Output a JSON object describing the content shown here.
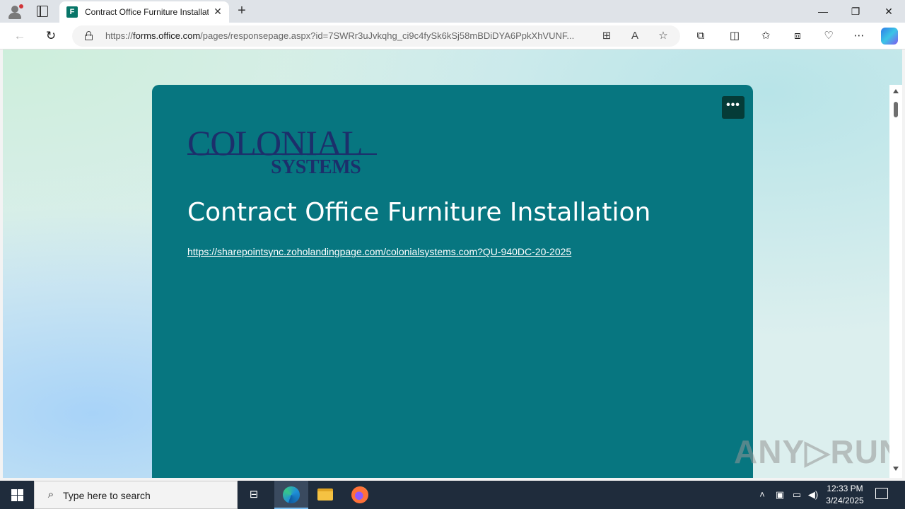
{
  "browser": {
    "tab": {
      "title": "Contract Office Furniture Installation",
      "favicon": "F"
    },
    "address": {
      "url_prefix": "https://",
      "url_domain": "forms.office.com",
      "url_rest": "/pages/responsepage.aspx?id=7SWRr3uJvkqhg_ci9c4fySk6kSj58mBDiDYA6PpkXhVUNF..."
    },
    "icons": [
      "back-icon",
      "refresh-icon",
      "lock-icon",
      "app-available-icon",
      "read-aloud-icon",
      "favorite-star-icon",
      "extensions-icon",
      "split-screen-icon",
      "favorites-icon",
      "collections-icon",
      "browser-essentials-icon",
      "more-icon",
      "copilot-icon"
    ]
  },
  "page": {
    "logo": {
      "line1": "COLONIAL",
      "line2": "SYSTEMS"
    },
    "form_title": "Contract Office Furniture Installation",
    "link": "https://sharepointsync.zoholandingpage.com/colonialsystems.com?QU-940DC-20-2025",
    "more_button": "•••",
    "colors": {
      "card": "#077680",
      "logo": "#1c2f6b"
    }
  },
  "watermark": "ANY▷RUN",
  "taskbar": {
    "search_placeholder": "Type here to search",
    "time": "12:33 PM",
    "date": "3/24/2025"
  }
}
